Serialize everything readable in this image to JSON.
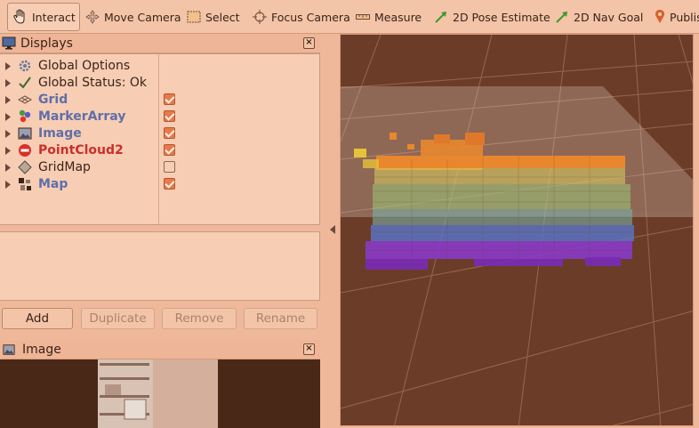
{
  "toolbar": {
    "tools": [
      {
        "label": "Interact",
        "icon": "hand-icon",
        "active": true
      },
      {
        "label": "Move Camera",
        "icon": "move-camera-icon"
      },
      {
        "label": "Select",
        "icon": "select-rect-icon"
      },
      {
        "label": "Focus Camera",
        "icon": "focus-crosshair-icon"
      },
      {
        "label": "Measure",
        "icon": "ruler-icon"
      },
      {
        "label": "2D Pose Estimate",
        "icon": "green-arrow-icon"
      },
      {
        "label": "2D Nav Goal",
        "icon": "green-arrow-icon"
      },
      {
        "label": "Publis",
        "icon": "map-pin-icon"
      }
    ]
  },
  "displays": {
    "title": "Displays",
    "items": [
      {
        "label": "Global Options",
        "icon": "gear-icon",
        "checked": null,
        "style": "normal"
      },
      {
        "label": "Global Status: Ok",
        "icon": "checkmark-icon",
        "checked": null,
        "style": "normal"
      },
      {
        "label": "Grid",
        "icon": "grid-icon",
        "checked": true,
        "style": "plugin"
      },
      {
        "label": "MarkerArray",
        "icon": "markers-icon",
        "checked": true,
        "style": "plugin"
      },
      {
        "label": "Image",
        "icon": "image-icon",
        "checked": true,
        "style": "plugin"
      },
      {
        "label": "PointCloud2",
        "icon": "error-icon",
        "checked": true,
        "style": "error"
      },
      {
        "label": "GridMap",
        "icon": "diamond-icon",
        "checked": false,
        "style": "normal"
      },
      {
        "label": "Map",
        "icon": "map-icon",
        "checked": true,
        "style": "plugin"
      }
    ],
    "buttons": {
      "add": "Add",
      "duplicate": "Duplicate",
      "remove": "Remove",
      "rename": "Rename"
    }
  },
  "image_panel": {
    "title": "Image"
  },
  "colors": {
    "accent": "#e77a4a",
    "plugin_text": "#5f6fa8",
    "error_text": "#c8302a",
    "viewport_bg": "#6b3d28"
  }
}
